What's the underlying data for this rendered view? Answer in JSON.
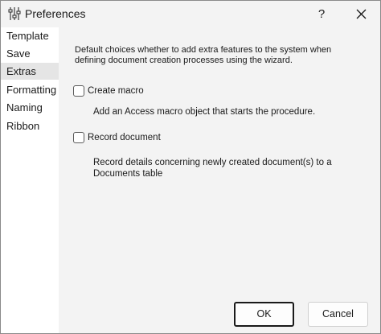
{
  "window": {
    "title": "Preferences",
    "help_label": "?"
  },
  "sidebar": {
    "items": [
      {
        "label": "Template",
        "selected": false
      },
      {
        "label": "Save",
        "selected": false
      },
      {
        "label": "Extras",
        "selected": true
      },
      {
        "label": "Formatting",
        "selected": false
      },
      {
        "label": "Naming",
        "selected": false
      },
      {
        "label": "Ribbon",
        "selected": false
      }
    ]
  },
  "extras": {
    "description": "Default choices whether to add extra features to the system when defining document creation processes using the wizard.",
    "options": [
      {
        "label": "Create macro",
        "checked": false,
        "description": "Add an Access macro object that starts the procedure."
      },
      {
        "label": "Record document",
        "checked": false,
        "description": "Record details concerning newly created document(s) to a Documents table"
      }
    ]
  },
  "footer": {
    "ok_label": "OK",
    "cancel_label": "Cancel"
  },
  "icons": {
    "title": "sliders-icon",
    "close": "close-icon"
  }
}
